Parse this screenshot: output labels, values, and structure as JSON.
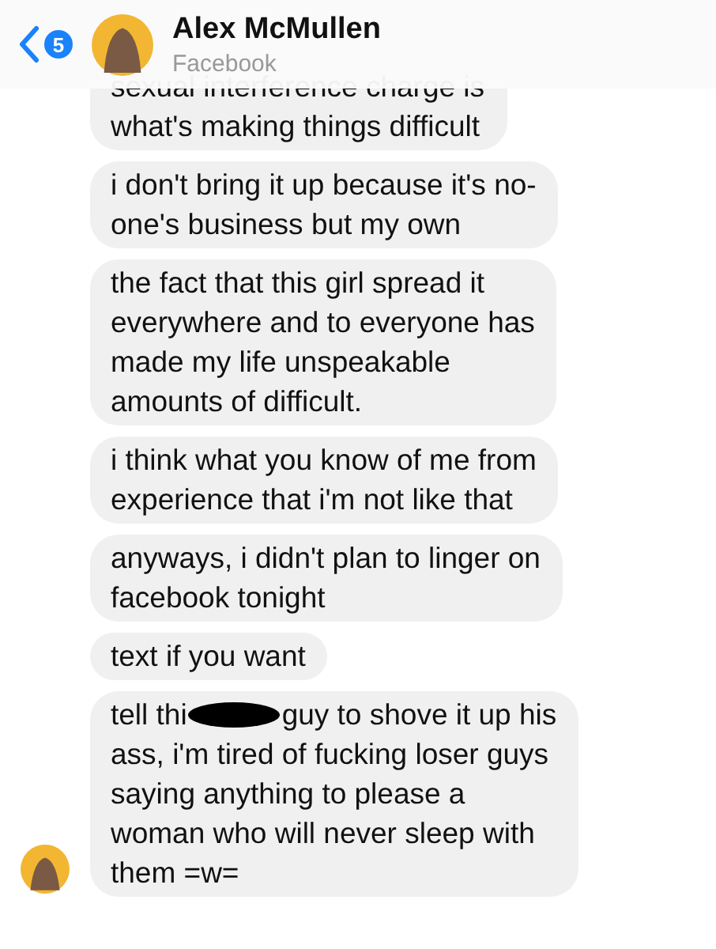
{
  "header": {
    "back_badge": "5",
    "name": "Alex McMullen",
    "subtitle": "Facebook"
  },
  "messages": [
    {
      "kind": "text",
      "lines": [
        "sexual interference charge is",
        "what's making things difficult"
      ]
    },
    {
      "kind": "text",
      "lines": [
        "i don't bring it up because it's no-",
        "one's business but my own"
      ]
    },
    {
      "kind": "text",
      "lines": [
        "the fact that this girl spread it",
        "everywhere and to everyone has",
        "made my life unspeakable",
        "amounts of difficult."
      ]
    },
    {
      "kind": "text",
      "lines": [
        "i think what you know of me from",
        "experience that i'm not like that"
      ]
    },
    {
      "kind": "text",
      "lines": [
        "anyways, i didn't plan to linger on",
        "facebook tonight"
      ]
    },
    {
      "kind": "text",
      "lines": [
        "text if you want"
      ]
    },
    {
      "kind": "redacted",
      "before": "tell thi",
      "after": "guy to shove it up his",
      "lines": [
        "ass, i'm tired of fucking loser guys",
        "saying anything to please a",
        "woman who will never sleep with",
        "them =w="
      ],
      "avatar": true
    }
  ]
}
